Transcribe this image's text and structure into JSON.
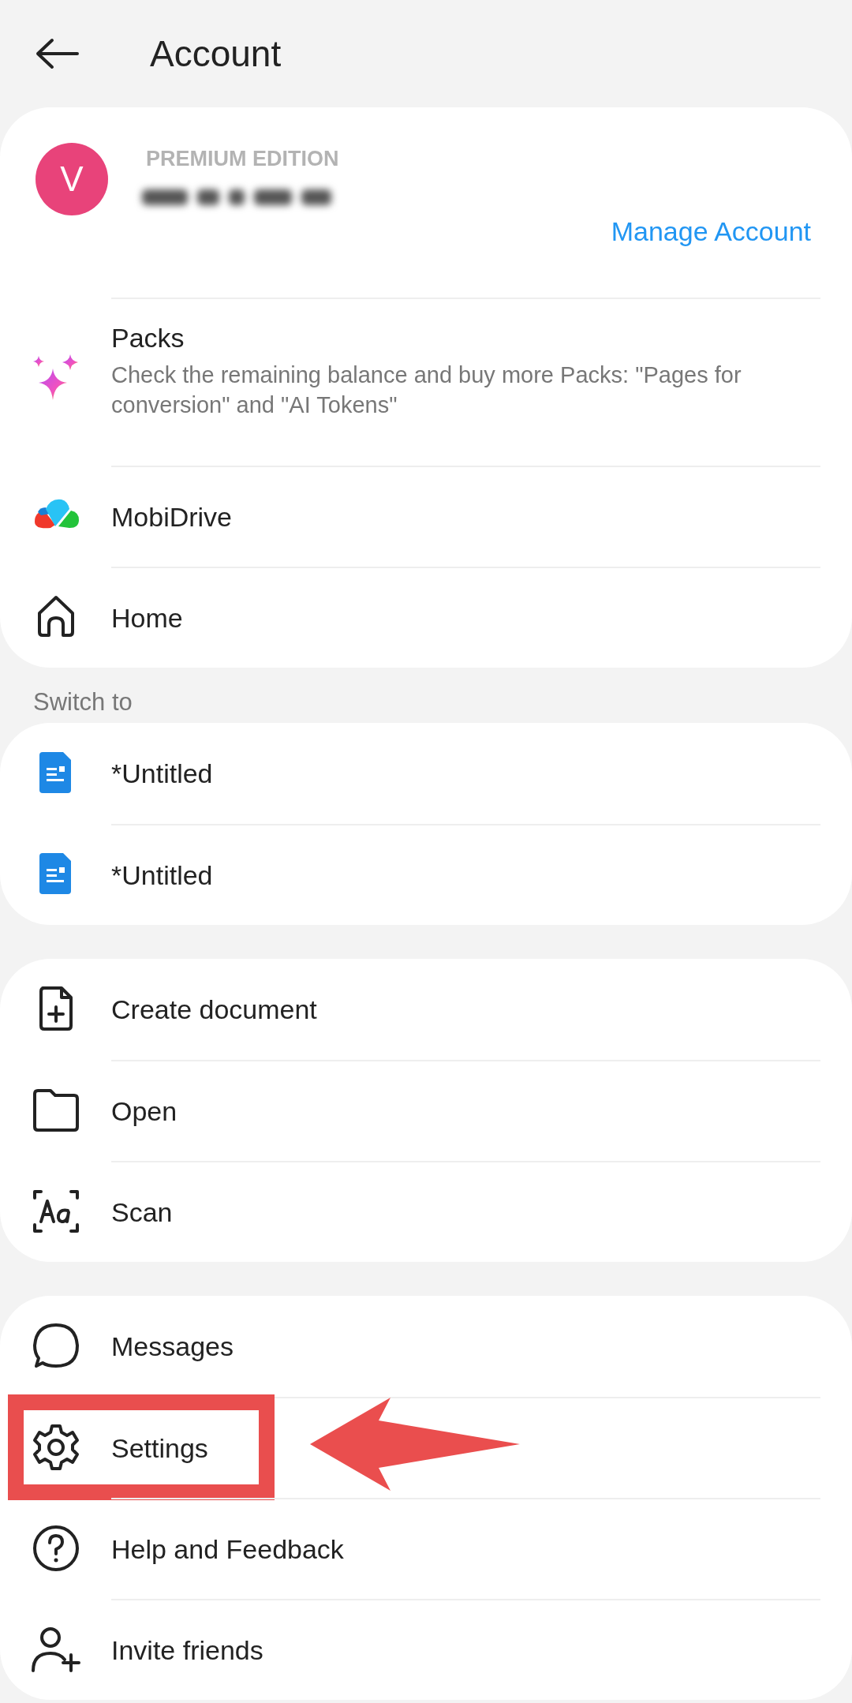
{
  "header": {
    "title": "Account"
  },
  "groups": [
    {
      "account": {
        "avatar_letter": "V",
        "edition": "PREMIUM EDITION",
        "manage_link": "Manage Account"
      },
      "items": [
        {
          "kind": "sparkles",
          "label": "Packs",
          "description": "Check the remaining balance and buy more Packs: \"Pages for conversion\" and \"AI Tokens\"",
          "highlighted": false
        },
        {
          "kind": "cloud",
          "label": "MobiDrive",
          "highlighted": false
        },
        {
          "kind": "home",
          "label": "Home",
          "highlighted": false
        }
      ]
    },
    {
      "heading": "Switch to",
      "items": [
        {
          "kind": "document",
          "label": "*Untitled",
          "highlighted": false
        },
        {
          "kind": "document",
          "label": "*Untitled",
          "highlighted": false
        }
      ]
    },
    {
      "items": [
        {
          "kind": "file-plus",
          "label": "Create document",
          "highlighted": false
        },
        {
          "kind": "folder",
          "label": "Open",
          "highlighted": false
        },
        {
          "kind": "scan",
          "label": "Scan",
          "highlighted": false
        }
      ]
    },
    {
      "items": [
        {
          "kind": "chat",
          "label": "Messages",
          "highlighted": false
        },
        {
          "kind": "gear",
          "label": "Settings",
          "highlighted": true
        },
        {
          "kind": "help",
          "label": "Help and Feedback",
          "highlighted": false
        },
        {
          "kind": "person-plus",
          "label": "Invite friends",
          "highlighted": false
        }
      ]
    }
  ]
}
